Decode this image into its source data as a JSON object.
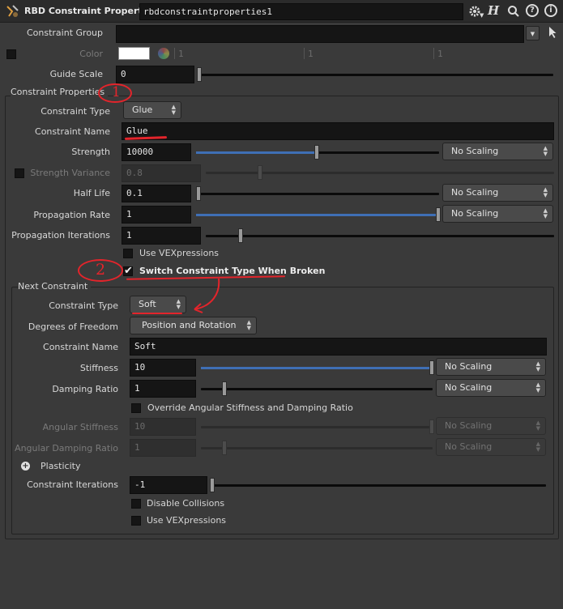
{
  "header": {
    "node_type": "RBD Constraint Properties",
    "node_name": "rbdconstraintproperties1",
    "icons": [
      "gear-icon",
      "help-h-icon",
      "search-icon",
      "help-icon",
      "info-icon"
    ]
  },
  "top": {
    "constraint_group_label": "Constraint Group",
    "constraint_group_value": "",
    "color_label": "Color",
    "color_swatch": "#ffffff",
    "color_values": [
      "1",
      "1",
      "1"
    ],
    "guide_scale_label": "Guide Scale",
    "guide_scale_value": "0",
    "guide_scale_fraction": 0
  },
  "constraint_properties": {
    "title": "Constraint Properties",
    "constraint_type_label": "Constraint Type",
    "constraint_type_value": "Glue",
    "constraint_name_label": "Constraint Name",
    "constraint_name_value": "Glue",
    "strength_label": "Strength",
    "strength_value": "10000",
    "strength_fraction": 0.5,
    "strength_scaling": "No Scaling",
    "strength_variance_label": "Strength Variance",
    "strength_variance_value": "0.8",
    "strength_variance_fraction": 0.8,
    "half_life_label": "Half Life",
    "half_life_value": "0.1",
    "half_life_fraction": 0,
    "half_life_scaling": "No Scaling",
    "propagation_rate_label": "Propagation Rate",
    "propagation_rate_value": "1",
    "propagation_rate_fraction": 1,
    "propagation_rate_scaling": "No Scaling",
    "propagation_iterations_label": "Propagation Iterations",
    "propagation_iterations_value": "1",
    "propagation_iterations_fraction": 0.1,
    "use_vexpressions_label": "Use VEXpressions",
    "switch_type_label": "Switch Constraint Type When Broken",
    "switch_type_checked": true
  },
  "next_constraint": {
    "title": "Next Constraint",
    "constraint_type_label": "Constraint Type",
    "constraint_type_value": "Soft",
    "dof_label": "Degrees of Freedom",
    "dof_value": "Position and Rotation",
    "constraint_name_label": "Constraint Name",
    "constraint_name_value": "Soft",
    "stiffness_label": "Stiffness",
    "stiffness_value": "10",
    "stiffness_fraction": 1,
    "stiffness_scaling": "No Scaling",
    "damping_label": "Damping Ratio",
    "damping_value": "1",
    "damping_fraction": 0.1,
    "damping_scaling": "No Scaling",
    "override_label": "Override Angular Stiffness and Damping Ratio",
    "angular_stiffness_label": "Angular Stiffness",
    "angular_stiffness_value": "10",
    "angular_stiffness_fraction": 1,
    "angular_stiffness_scaling": "No Scaling",
    "angular_damping_label": "Angular Damping Ratio",
    "angular_damping_value": "1",
    "angular_damping_fraction": 0.1,
    "angular_damping_scaling": "No Scaling",
    "plasticity_label": "Plasticity",
    "constraint_iterations_label": "Constraint Iterations",
    "constraint_iterations_value": "-1",
    "constraint_iterations_fraction": 0,
    "disable_collisions_label": "Disable Collisions",
    "use_vexpressions_label": "Use VEXpressions"
  },
  "annotations": {
    "marker_1": "1",
    "marker_2": "2",
    "color": "#e3242b"
  }
}
